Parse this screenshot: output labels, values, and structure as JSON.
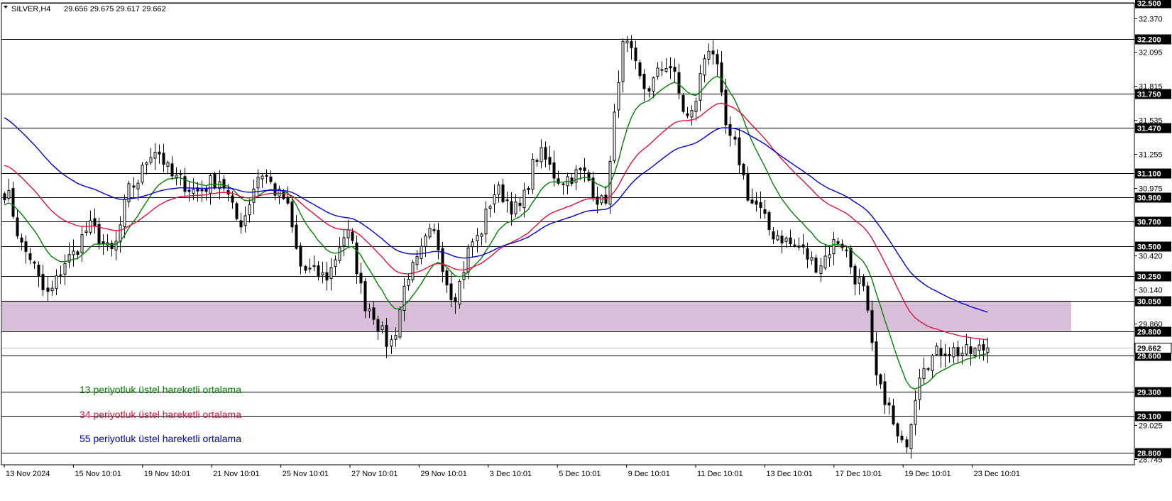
{
  "header": {
    "symbol": "SILVER,H4",
    "ohlc": "29.656 29.675 29.617 29.662"
  },
  "legend": [
    {
      "label": "13 periyotluk üstel hareketli ortalama",
      "color": "#008000"
    },
    {
      "label": "34 periyotluk üstel hareketli ortalama",
      "color": "#e0103a"
    },
    {
      "label": "55 periyotluk üstel hareketli ortalama",
      "color": "#0000cc"
    }
  ],
  "chart_data": {
    "type": "candlestick",
    "ylim": [
      28.7,
      32.5
    ],
    "grid": false,
    "price_ticks": [
      "32.370",
      "32.095",
      "31.815",
      "31.535",
      "31.255",
      "30.975",
      "30.420",
      "30.140",
      "29.860",
      "29.025",
      "28.745"
    ],
    "levels": [
      {
        "label": "32.500",
        "value": 32.5
      },
      {
        "label": "32.200",
        "value": 32.2
      },
      {
        "label": "31.750",
        "value": 31.75
      },
      {
        "label": "31.470",
        "value": 31.47
      },
      {
        "label": "31.100",
        "value": 31.1
      },
      {
        "label": "30.900",
        "value": 30.9
      },
      {
        "label": "30.700",
        "value": 30.7
      },
      {
        "label": "30.500",
        "value": 30.5
      },
      {
        "label": "30.250",
        "value": 30.25
      },
      {
        "label": "30.050",
        "value": 30.05
      },
      {
        "label": "29.800",
        "value": 29.8
      },
      {
        "label": "29.600",
        "value": 29.6
      },
      {
        "label": "29.300",
        "value": 29.3
      },
      {
        "label": "29.100",
        "value": 29.1
      },
      {
        "label": "28.800",
        "value": 28.8
      }
    ],
    "current_price": {
      "label": "29.662",
      "value": 29.662
    },
    "zone": {
      "from": 29.8,
      "to": 30.05,
      "color": "#d8bfd8"
    },
    "time_labels": [
      "13 Nov 2024",
      "15 Nov 10:01",
      "19 Nov 10:01",
      "21 Nov 10:01",
      "25 Nov 10:01",
      "27 Nov 10:01",
      "29 Nov 10:01",
      "3 Dec 10:01",
      "5 Dec 10:01",
      "9 Dec 10:01",
      "11 Dec 10:01",
      "13 Dec 10:01",
      "17 Dec 10:01",
      "19 Dec 10:01",
      "23 Dec 10:01"
    ],
    "anchors": [
      30.95,
      30.45,
      30.1,
      30.4,
      30.65,
      30.45,
      31.0,
      31.3,
      31.05,
      30.95,
      31.05,
      30.7,
      31.1,
      30.9,
      30.3,
      30.25,
      30.6,
      30.0,
      29.7,
      30.3,
      30.6,
      30.1,
      30.55,
      30.95,
      30.8,
      31.25,
      31.05,
      31.1,
      30.85,
      32.15,
      31.8,
      32.0,
      31.55,
      32.15,
      31.35,
      30.85,
      30.6,
      30.5,
      30.35,
      30.55,
      30.2,
      29.3,
      28.85,
      29.55,
      29.65,
      29.62,
      29.662
    ],
    "series": [
      {
        "name": "13 periyotluk üstel hareketli ortalama",
        "period": 13,
        "color": "#008000"
      },
      {
        "name": "34 periyotluk üstel hareketli ortalama",
        "period": 34,
        "color": "#e0103a"
      },
      {
        "name": "55 periyotluk üstel hareketli ortalama",
        "period": 55,
        "color": "#0000cc"
      }
    ]
  }
}
